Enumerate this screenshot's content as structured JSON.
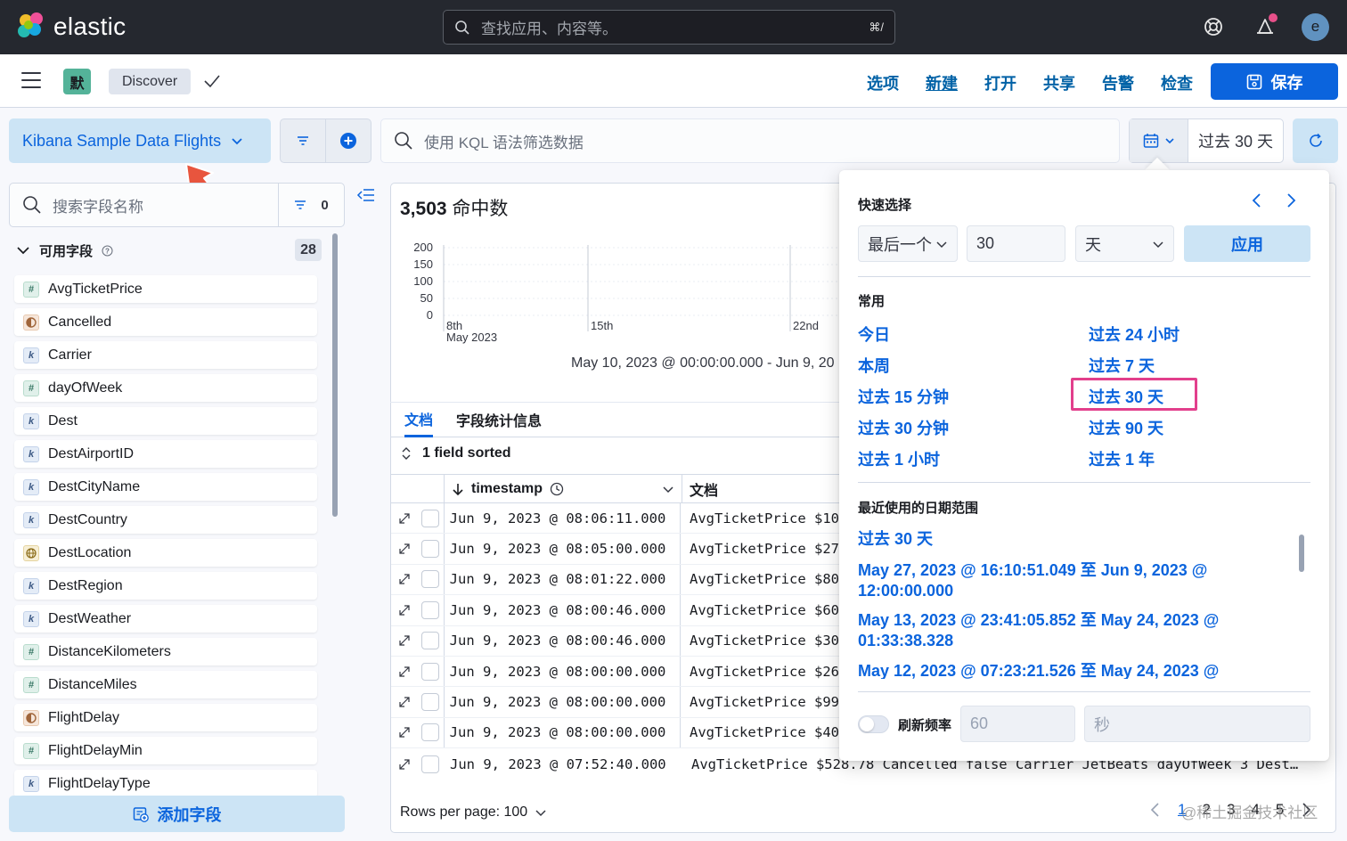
{
  "header": {
    "logo_text": "elastic",
    "search_placeholder": "查找应用、内容等。",
    "search_shortcut": "⌘/",
    "avatar_initial": "e"
  },
  "appbar": {
    "space_badge": "默",
    "breadcrumb": "Discover",
    "links": [
      "选项",
      "新建",
      "打开",
      "共享",
      "告警",
      "检查"
    ],
    "save_label": "保存"
  },
  "query": {
    "data_view": "Kibana Sample Data Flights",
    "kql_placeholder": "使用 KQL 语法筛选数据",
    "date_label": "过去 30 天"
  },
  "sidebar": {
    "search_placeholder": "搜索字段名称",
    "filter_count": "0",
    "available_label": "可用字段",
    "available_count": "28",
    "fields": [
      {
        "name": "AvgTicketPrice",
        "type": "num"
      },
      {
        "name": "Cancelled",
        "type": "bool"
      },
      {
        "name": "Carrier",
        "type": "kw"
      },
      {
        "name": "dayOfWeek",
        "type": "num"
      },
      {
        "name": "Dest",
        "type": "kw"
      },
      {
        "name": "DestAirportID",
        "type": "kw"
      },
      {
        "name": "DestCityName",
        "type": "kw"
      },
      {
        "name": "DestCountry",
        "type": "kw"
      },
      {
        "name": "DestLocation",
        "type": "geo"
      },
      {
        "name": "DestRegion",
        "type": "kw"
      },
      {
        "name": "DestWeather",
        "type": "kw"
      },
      {
        "name": "DistanceKilometers",
        "type": "num"
      },
      {
        "name": "DistanceMiles",
        "type": "num"
      },
      {
        "name": "FlightDelay",
        "type": "bool"
      },
      {
        "name": "FlightDelayMin",
        "type": "num"
      },
      {
        "name": "FlightDelayType",
        "type": "kw"
      }
    ],
    "add_field_label": "添加字段"
  },
  "main": {
    "hits_count": "3,503",
    "hits_label": "命中数",
    "chart_y_ticks": [
      "200",
      "150",
      "100",
      "50",
      "0"
    ],
    "chart_x_ticks": [
      "8th",
      "15th",
      "22nd"
    ],
    "chart_x_sub": "May 2023",
    "range_text": "May 10, 2023 @ 00:00:00.000 - Jun 9, 20",
    "tabs": [
      "文档",
      "字段统计信息"
    ],
    "sorted_label": "1 field sorted",
    "col_timestamp": "timestamp",
    "col_doc": "文档",
    "rows": [
      {
        "ts": "Jun 9, 2023 @ 08:06:11.000",
        "doc": "AvgTicketPrice $10"
      },
      {
        "ts": "Jun 9, 2023 @ 08:05:00.000",
        "doc": "AvgTicketPrice $27"
      },
      {
        "ts": "Jun 9, 2023 @ 08:01:22.000",
        "doc": "AvgTicketPrice $80"
      },
      {
        "ts": "Jun 9, 2023 @ 08:00:46.000",
        "doc": "AvgTicketPrice $60"
      },
      {
        "ts": "Jun 9, 2023 @ 08:00:46.000",
        "doc": "AvgTicketPrice $30"
      },
      {
        "ts": "Jun 9, 2023 @ 08:00:00.000",
        "doc": "AvgTicketPrice $26"
      },
      {
        "ts": "Jun 9, 2023 @ 08:00:00.000",
        "doc": "AvgTicketPrice $99"
      },
      {
        "ts": "Jun 9, 2023 @ 08:00:00.000",
        "doc": "AvgTicketPrice $40"
      }
    ],
    "last_row_ts": "Jun 9, 2023 @ 07:52:40.000",
    "last_row_doc": "AvgTicketPrice $528.78 Cancelled false Carrier JetBeats dayOfWeek 3 Dest…",
    "rows_per_page": "Rows per page: 100",
    "pages": [
      "1",
      "2",
      "3",
      "4",
      "5"
    ],
    "watermark": "@稀土掘金技术社区"
  },
  "popover": {
    "quick_title": "快速选择",
    "unit_dir": "最后一个",
    "amount": "30",
    "unit": "天",
    "apply": "应用",
    "common_title": "常用",
    "common_left": [
      "今日",
      "本周",
      "过去 15 分钟",
      "过去 30 分钟",
      "过去 1 小时"
    ],
    "common_right": [
      "过去 24 小时",
      "过去 7 天",
      "过去 30 天",
      "过去 90 天",
      "过去 1 年"
    ],
    "recent_title": "最近使用的日期范围",
    "recent": [
      "过去 30 天",
      "May 27, 2023 @ 16:10:51.049 至 Jun 9, 2023 @ 12:00:00.000",
      "May 13, 2023 @ 23:41:05.852 至 May 24, 2023 @ 01:33:38.328",
      "May 12, 2023 @ 07:23:21.526 至 May 24, 2023 @"
    ],
    "refresh_label": "刷新频率",
    "refresh_value": "60",
    "refresh_unit": "秒"
  },
  "colors": {
    "accent": "#0b64dd",
    "highlight": "#e23f8c",
    "pointer": "#e8553e"
  }
}
